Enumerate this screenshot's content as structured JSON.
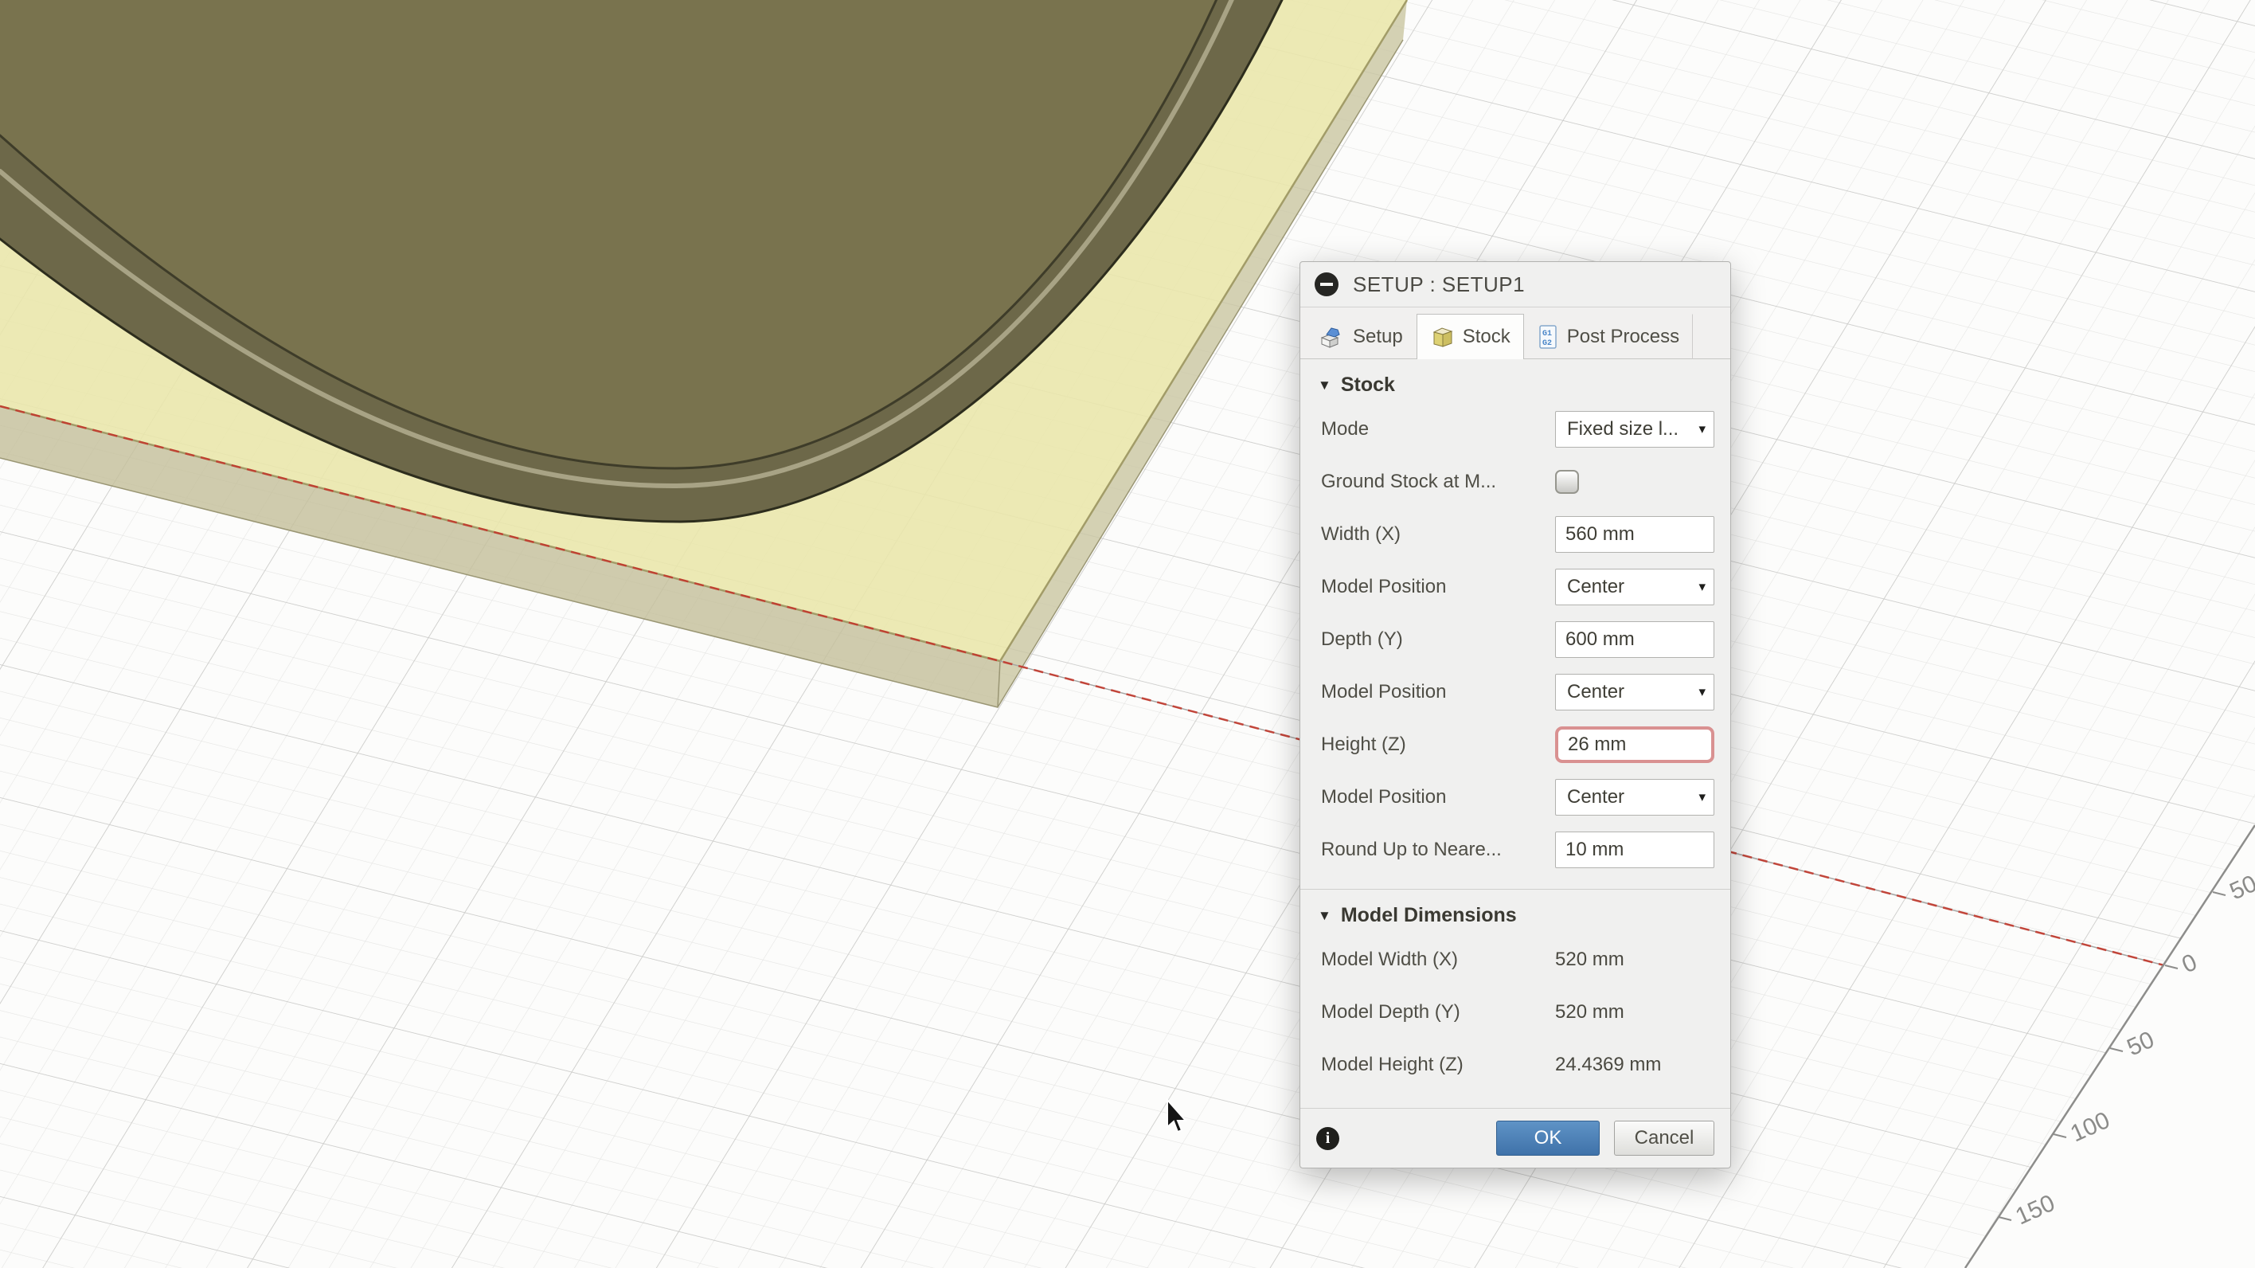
{
  "viewport": {
    "ruler": {
      "labels": [
        "50",
        "0",
        "50",
        "100",
        "150"
      ]
    },
    "colors": {
      "background": "#fcfcfb",
      "grid_minor": "#e4e4e2",
      "grid_major": "#c9c9c7",
      "stock_top": "#e9e6aa",
      "stock_side": "#c4c09b",
      "model_fill": "#79734e",
      "model_side": "#6d6849",
      "rim_highlight": "#a8a385",
      "axis_red": "#c2392c"
    }
  },
  "dialog": {
    "title": "SETUP : SETUP1",
    "tabs": [
      {
        "label": "Setup",
        "active": false
      },
      {
        "label": "Stock",
        "active": true
      },
      {
        "label": "Post Process",
        "active": false
      }
    ],
    "stock": {
      "header": "Stock",
      "rows": [
        {
          "label": "Mode",
          "type": "dropdown",
          "value": "Fixed size l..."
        },
        {
          "label": "Ground Stock at M...",
          "type": "checkbox",
          "checked": false
        },
        {
          "label": "Width (X)",
          "type": "input",
          "value": "560 mm"
        },
        {
          "label": "Model Position",
          "type": "dropdown",
          "value": "Center"
        },
        {
          "label": "Depth (Y)",
          "type": "input",
          "value": "600 mm"
        },
        {
          "label": "Model Position",
          "type": "dropdown",
          "value": "Center"
        },
        {
          "label": "Height (Z)",
          "type": "input",
          "value": "26 mm",
          "highlighted": true
        },
        {
          "label": "Model Position",
          "type": "dropdown",
          "value": "Center"
        },
        {
          "label": "Round Up to Neare...",
          "type": "input",
          "value": "10 mm"
        }
      ]
    },
    "model_dimensions": {
      "header": "Model Dimensions",
      "rows": [
        {
          "label": "Model Width (X)",
          "value": "520 mm"
        },
        {
          "label": "Model Depth (Y)",
          "value": "520 mm"
        },
        {
          "label": "Model Height (Z)",
          "value": "24.4369 mm"
        }
      ]
    },
    "footer": {
      "ok_label": "OK",
      "cancel_label": "Cancel"
    },
    "accent_blue": "#3f72a9",
    "highlight_border": "#d99191"
  },
  "glyphs": {
    "section_caret": "▼",
    "dropdown_caret": "▾",
    "info": "i"
  }
}
